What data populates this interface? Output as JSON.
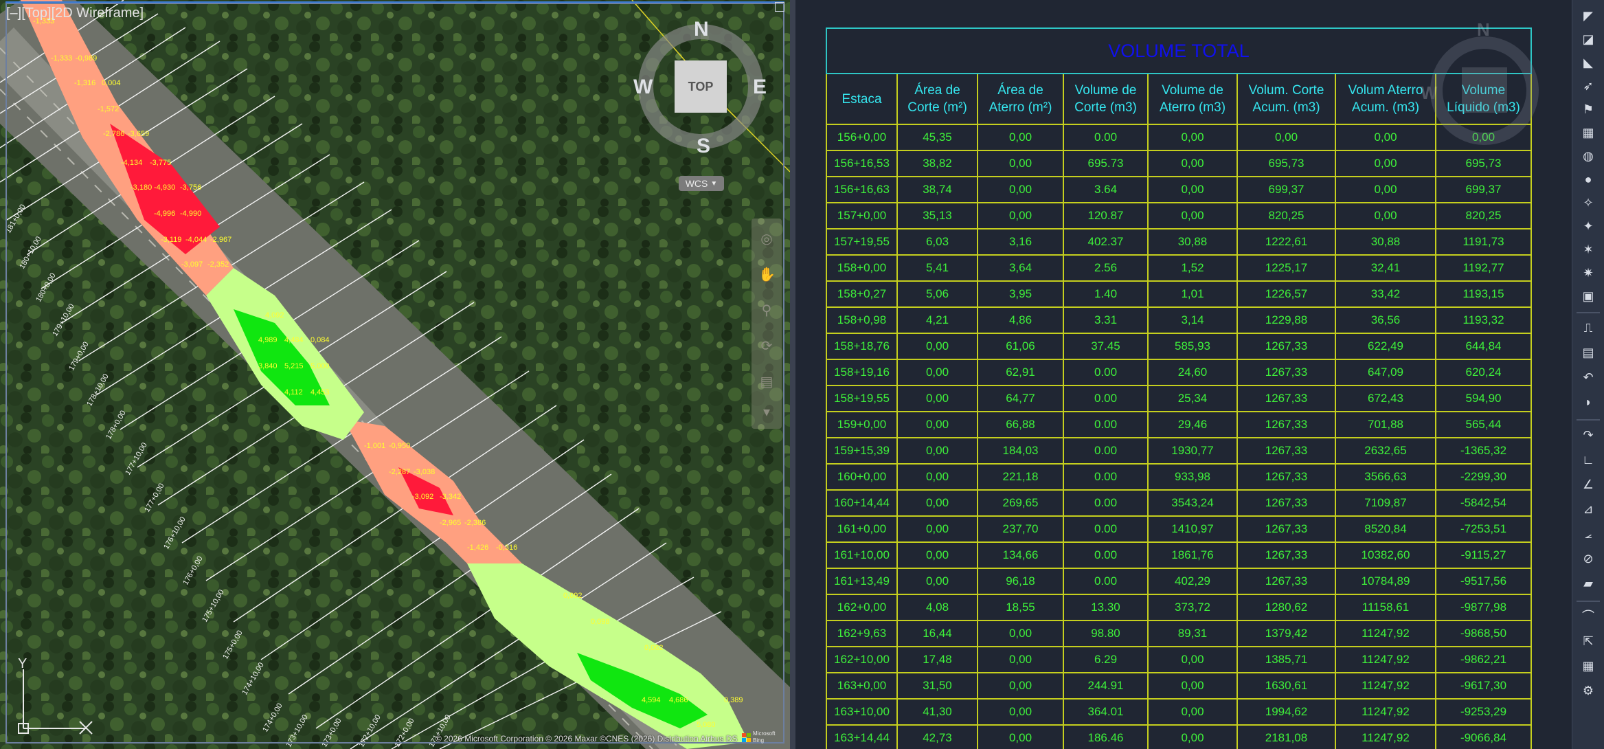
{
  "viewport": {
    "label": "[–][Top][2D Wireframe]",
    "viewcube": {
      "north": "N",
      "south": "S",
      "east": "E",
      "west": "W",
      "face": "TOP"
    },
    "wcs_label": "WCS",
    "copyright": "© 2026 Microsoft Corporation © 2026 Maxar ©CNES (2026) Distribution Airbus DS",
    "ms_logo_text": "Microsoft Bing",
    "ucs": {
      "y_axis": "Y"
    },
    "station_labels": [
      "181+0,00",
      "180+10,00",
      "180+0,00",
      "179+10,00",
      "179+0,00",
      "178+10,00",
      "178+0,00",
      "177+10,00",
      "177+0,00",
      "176+10,00",
      "176+0,00",
      "175+10,00",
      "175+0,00",
      "174+10,00",
      "174+0,00",
      "173+10,00",
      "173+0,00",
      "172+10,00",
      "172+0,00",
      "171+10,00"
    ],
    "cut_labels": [
      "-1,333",
      "-0,989",
      "-1,316",
      "0,004",
      "-1,572",
      "-2,786",
      "-3,659",
      "-4,134",
      "-3,775",
      "-3,180",
      "-4,930",
      "-3,756",
      "-4,996",
      "-4,990",
      "-3,119",
      "-4,044",
      "-2,967",
      "-3,097",
      "-2,352",
      "-1,001",
      "-0,950",
      "-2,287",
      "-3,038",
      "-3,092",
      "-3,342",
      "-2,965",
      "-2,386",
      "-1,426",
      "-0,316"
    ],
    "fill_labels": [
      "4,092",
      "4,989",
      "4,484",
      "0,084",
      "3,840",
      "5,215",
      "5,000",
      "4,112",
      "4,453",
      "0,092",
      "0,098",
      "0,062",
      "4,594",
      "4,686",
      "0,389",
      "5,080"
    ],
    "colors": {
      "cut_light": "#ffa080",
      "cut_dark": "#ff1a3a",
      "fill_light": "#c6ff8a",
      "fill_dark": "#10e610",
      "label_yellow": "#ffff30"
    }
  },
  "table": {
    "title": "VOLUME TOTAL",
    "columns": [
      [
        "Estaca"
      ],
      [
        "Área de",
        "Corte (m²)"
      ],
      [
        "Área de",
        "Aterro (m²)"
      ],
      [
        "Volume de",
        "Corte (m3)"
      ],
      [
        "Volume de",
        "Aterro (m3)"
      ],
      [
        "Volum. Corte",
        "Acum. (m3)"
      ],
      [
        "Volum Aterro",
        "Acum. (m3)"
      ],
      [
        "Volume",
        "Líquido (m3)"
      ]
    ],
    "rows": [
      [
        "156+0,00",
        "45,35",
        "0,00",
        "0.00",
        "0,00",
        "0,00",
        "0,00",
        "0,00"
      ],
      [
        "156+16,53",
        "38,82",
        "0,00",
        "695.73",
        "0,00",
        "695,73",
        "0,00",
        "695,73"
      ],
      [
        "156+16,63",
        "38,74",
        "0,00",
        "3.64",
        "0,00",
        "699,37",
        "0,00",
        "699,37"
      ],
      [
        "157+0,00",
        "35,13",
        "0,00",
        "120.87",
        "0,00",
        "820,25",
        "0,00",
        "820,25"
      ],
      [
        "157+19,55",
        "6,03",
        "3,16",
        "402.37",
        "30,88",
        "1222,61",
        "30,88",
        "1191,73"
      ],
      [
        "158+0,00",
        "5,41",
        "3,64",
        "2.56",
        "1,52",
        "1225,17",
        "32,41",
        "1192,77"
      ],
      [
        "158+0,27",
        "5,06",
        "3,95",
        "1.40",
        "1,01",
        "1226,57",
        "33,42",
        "1193,15"
      ],
      [
        "158+0,98",
        "4,21",
        "4,86",
        "3.31",
        "3,14",
        "1229,88",
        "36,56",
        "1193,32"
      ],
      [
        "158+18,76",
        "0,00",
        "61,06",
        "37.45",
        "585,93",
        "1267,33",
        "622,49",
        "644,84"
      ],
      [
        "158+19,16",
        "0,00",
        "62,91",
        "0.00",
        "24,60",
        "1267,33",
        "647,09",
        "620,24"
      ],
      [
        "158+19,55",
        "0,00",
        "64,77",
        "0.00",
        "25,34",
        "1267,33",
        "672,43",
        "594,90"
      ],
      [
        "159+0,00",
        "0,00",
        "66,88",
        "0.00",
        "29,46",
        "1267,33",
        "701,88",
        "565,44"
      ],
      [
        "159+15,39",
        "0,00",
        "184,03",
        "0.00",
        "1930,77",
        "1267,33",
        "2632,65",
        "-1365,32"
      ],
      [
        "160+0,00",
        "0,00",
        "221,18",
        "0.00",
        "933,98",
        "1267,33",
        "3566,63",
        "-2299,30"
      ],
      [
        "160+14,44",
        "0,00",
        "269,65",
        "0.00",
        "3543,24",
        "1267,33",
        "7109,87",
        "-5842,54"
      ],
      [
        "161+0,00",
        "0,00",
        "237,70",
        "0.00",
        "1410,97",
        "1267,33",
        "8520,84",
        "-7253,51"
      ],
      [
        "161+10,00",
        "0,00",
        "134,66",
        "0.00",
        "1861,76",
        "1267,33",
        "10382,60",
        "-9115,27"
      ],
      [
        "161+13,49",
        "0,00",
        "96,18",
        "0.00",
        "402,29",
        "1267,33",
        "10784,89",
        "-9517,56"
      ],
      [
        "162+0,00",
        "4,08",
        "18,55",
        "13.30",
        "373,72",
        "1280,62",
        "11158,61",
        "-9877,98"
      ],
      [
        "162+9,63",
        "16,44",
        "0,00",
        "98.80",
        "89,31",
        "1379,42",
        "11247,92",
        "-9868,50"
      ],
      [
        "162+10,00",
        "17,48",
        "0,00",
        "6.29",
        "0,00",
        "1385,71",
        "11247,92",
        "-9862,21"
      ],
      [
        "163+0,00",
        "31,50",
        "0,00",
        "244.91",
        "0,00",
        "1630,61",
        "11247,92",
        "-9617,30"
      ],
      [
        "163+10,00",
        "41,30",
        "0,00",
        "364.01",
        "0,00",
        "1994,62",
        "11247,92",
        "-9253,29"
      ],
      [
        "163+14,44",
        "42,73",
        "0,00",
        "186.46",
        "0,00",
        "2181,08",
        "11247,92",
        "-9066,84"
      ]
    ],
    "colors": {
      "grid": "#c5cf1e",
      "title": "#1010ee",
      "header": "#35e6ef",
      "cell": "#3ef03a",
      "title_border": "#2ec6c6"
    }
  },
  "toolbar": {
    "icons": [
      "corner-drag-icon",
      "sheet-icon",
      "bevel-icon",
      "pointer-icon",
      "flag-icon",
      "layers-icon",
      "globe-icon",
      "globe-blue-icon",
      "star-point-icon",
      "star-text-icon",
      "star-pick-icon",
      "star-settings-icon",
      "image-icon",
      "polyline-icon",
      "properties-icon",
      "undo-arc-icon",
      "shape-icon",
      "redo-arc-icon",
      "angle-icon",
      "angle-2-icon",
      "angle-3-icon",
      "angle-4-icon",
      "circle-slash-icon",
      "paint-icon",
      "curve-icon",
      "select-icon",
      "grid-icon",
      "settings-icon"
    ]
  }
}
